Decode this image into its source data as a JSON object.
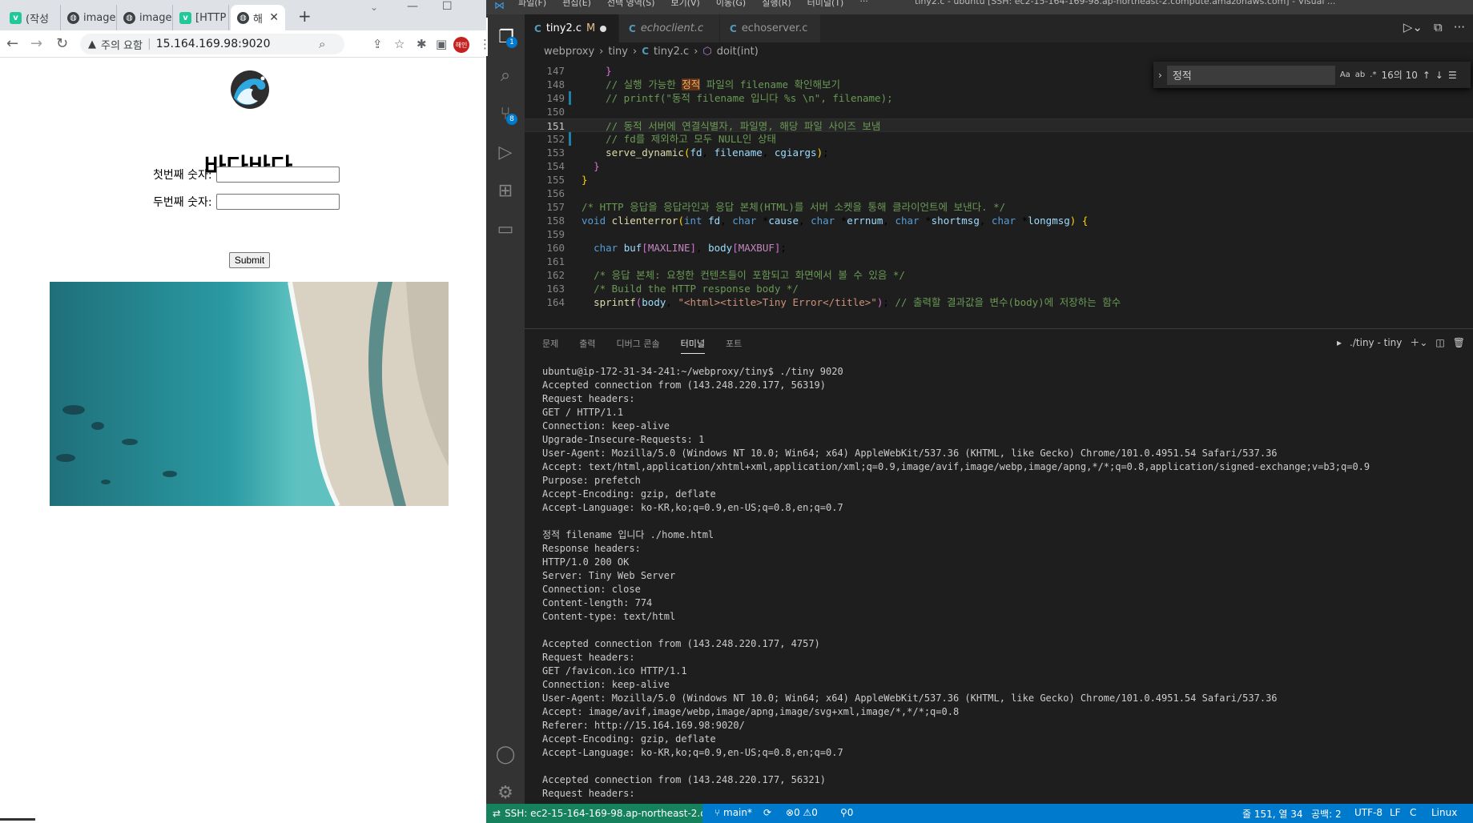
{
  "browser": {
    "tabs": [
      {
        "icon": "v",
        "label": "(작성"
      },
      {
        "icon": "globe",
        "label": "image"
      },
      {
        "icon": "globe",
        "label": "image"
      },
      {
        "icon": "v",
        "label": "[HTTP"
      },
      {
        "icon": "globe",
        "label": "해",
        "active": true
      }
    ],
    "new_tab": "+",
    "address": {
      "warning": "주의 요함",
      "url": "15.164.169.98:9020"
    },
    "profile": "해인",
    "page": {
      "title": "바다바다",
      "field1_label": "첫번째 숫자:",
      "field2_label": "두번째 숫자:",
      "submit_label": "Submit"
    }
  },
  "vscode": {
    "menus": [
      "파일(F)",
      "편집(E)",
      "선택 영역(S)",
      "보기(V)",
      "이동(G)",
      "실행(R)",
      "터미널(T)",
      "···"
    ],
    "window_title": "tiny2.c - ubuntu [SSH: ec2-15-164-169-98.ap-northeast-2.compute.amazonaws.com] - Visual ...",
    "activity_badges": {
      "explorer": "1",
      "scm": "8"
    },
    "tabs": [
      {
        "icon": "C",
        "label": "tiny2.c",
        "flag": "M",
        "active": true
      },
      {
        "icon": "C",
        "label": "echoclient.c",
        "italic": true
      },
      {
        "icon": "C",
        "label": "echoserver.c"
      }
    ],
    "breadcrumb": [
      "webproxy",
      "tiny",
      "tiny2.c",
      "doit(int)"
    ],
    "find": {
      "query": "정적",
      "count": "16의 10",
      "options": [
        "Aa",
        "ab",
        ".*"
      ]
    },
    "code_lines": [
      {
        "n": "147",
        "html": "    <span class='br2'>}</span>"
      },
      {
        "n": "148",
        "html": "    <span class='cm'>// 실행 가능한 <span class='hl'>정적</span> 파일의 filename 확인해보기</span>"
      },
      {
        "n": "149",
        "html": "    <span class='cm'>// printf(\"동적 filename 입니다 %s \\n\", filename);</span>",
        "mod": true
      },
      {
        "n": "150",
        "html": ""
      },
      {
        "n": "151",
        "html": "    <span class='cm'>// 동적 서버에 연결식별자, 파일명, 해당 파일 사이즈 보냄</span>",
        "cur": true
      },
      {
        "n": "152",
        "html": "    <span class='cm'>// fd를 제외하고 모두 NULL인 상태</span>",
        "mod": true
      },
      {
        "n": "153",
        "html": "    <span class='fn'>serve_dynamic</span><span class='br1'>(</span><span class='va'>fd</span>, <span class='va'>filename</span>, <span class='va'>cgiargs</span><span class='br1'>)</span>;"
      },
      {
        "n": "154",
        "html": "  <span class='br2'>}</span>"
      },
      {
        "n": "155",
        "html": "<span class='br1'>}</span>"
      },
      {
        "n": "156",
        "html": ""
      },
      {
        "n": "157",
        "html": "<span class='cm'>/* HTTP 응답을 응답라인과 응답 본체(HTML)를 서버 소켓을 통해 클라이언트에 보낸다. */</span>"
      },
      {
        "n": "158",
        "html": "<span class='kw'>void</span> <span class='fn'>clienterror</span><span class='br1'>(</span><span class='kw'>int</span> <span class='va'>fd</span>, <span class='kw'>char</span> *<span class='va'>cause</span>, <span class='kw'>char</span> *<span class='va'>errnum</span>, <span class='kw'>char</span> *<span class='va'>shortmsg</span>, <span class='kw'>char</span> *<span class='va'>longmsg</span><span class='br1'>)</span> <span class='br1'>{</span>"
      },
      {
        "n": "159",
        "html": ""
      },
      {
        "n": "160",
        "html": "  <span class='kw'>char</span> <span class='va'>buf</span><span class='br2'>[</span><span class='mc'>MAXLINE</span><span class='br2'>]</span>, <span class='va'>body</span><span class='br2'>[</span><span class='mc'>MAXBUF</span><span class='br2'>]</span>;"
      },
      {
        "n": "161",
        "html": ""
      },
      {
        "n": "162",
        "html": "  <span class='cm'>/* 응답 본체: 요청한 컨텐츠들이 포함되고 화면에서 볼 수 있음 */</span>"
      },
      {
        "n": "163",
        "html": "  <span class='cm'>/* Build the HTTP response body */</span>"
      },
      {
        "n": "164",
        "html": "  <span class='fn'>sprintf</span><span class='br2'>(</span><span class='va'>body</span>, <span class='st'>\"&lt;html&gt;&lt;title&gt;Tiny Error&lt;/title&gt;\"</span><span class='br2'>)</span>; <span class='cm'>// 출력할 결과값을 변수(body)에 저장하는 함수</span>"
      }
    ],
    "panel_tabs": [
      "문제",
      "출력",
      "디버그 콘솔",
      "터미널",
      "포트"
    ],
    "panel_active": "터미널",
    "terminal_name": "./tiny - tiny",
    "terminal_lines": [
      "ubuntu@ip-172-31-34-241:~/webproxy/tiny$ ./tiny 9020",
      "Accepted connection from (143.248.220.177, 56319)",
      "Request headers:",
      "GET / HTTP/1.1",
      "Connection: keep-alive",
      "Upgrade-Insecure-Requests: 1",
      "User-Agent: Mozilla/5.0 (Windows NT 10.0; Win64; x64) AppleWebKit/537.36 (KHTML, like Gecko) Chrome/101.0.4951.54 Safari/537.36",
      "Accept: text/html,application/xhtml+xml,application/xml;q=0.9,image/avif,image/webp,image/apng,*/*;q=0.8,application/signed-exchange;v=b3;q=0.9",
      "Purpose: prefetch",
      "Accept-Encoding: gzip, deflate",
      "Accept-Language: ko-KR,ko;q=0.9,en-US;q=0.8,en;q=0.7",
      "",
      "정적 filename 입니다 ./home.html",
      "Response headers:",
      "HTTP/1.0 200 OK",
      "Server: Tiny Web Server",
      "Connection: close",
      "Content-length: 774",
      "Content-type: text/html",
      "",
      "Accepted connection from (143.248.220.177, 4757)",
      "Request headers:",
      "GET /favicon.ico HTTP/1.1",
      "Connection: keep-alive",
      "User-Agent: Mozilla/5.0 (Windows NT 10.0; Win64; x64) AppleWebKit/537.36 (KHTML, like Gecko) Chrome/101.0.4951.54 Safari/537.36",
      "Accept: image/avif,image/webp,image/apng,image/svg+xml,image/*,*/*;q=0.8",
      "Referer: http://15.164.169.98:9020/",
      "Accept-Encoding: gzip, deflate",
      "Accept-Language: ko-KR,ko;q=0.9,en-US;q=0.8,en;q=0.7",
      "",
      "Accepted connection from (143.248.220.177, 56321)",
      "Request headers:"
    ],
    "status": {
      "remote": "SSH: ec2-15-164-169-98.ap-northeast-2.co...",
      "branch": "main*",
      "errors": "0",
      "warnings": "0",
      "ports": "0",
      "position": "줄 151, 열 34",
      "spaces": "공백: 2",
      "encoding": "UTF-8",
      "eol": "LF",
      "language_short": "C",
      "os": "Linux"
    }
  }
}
